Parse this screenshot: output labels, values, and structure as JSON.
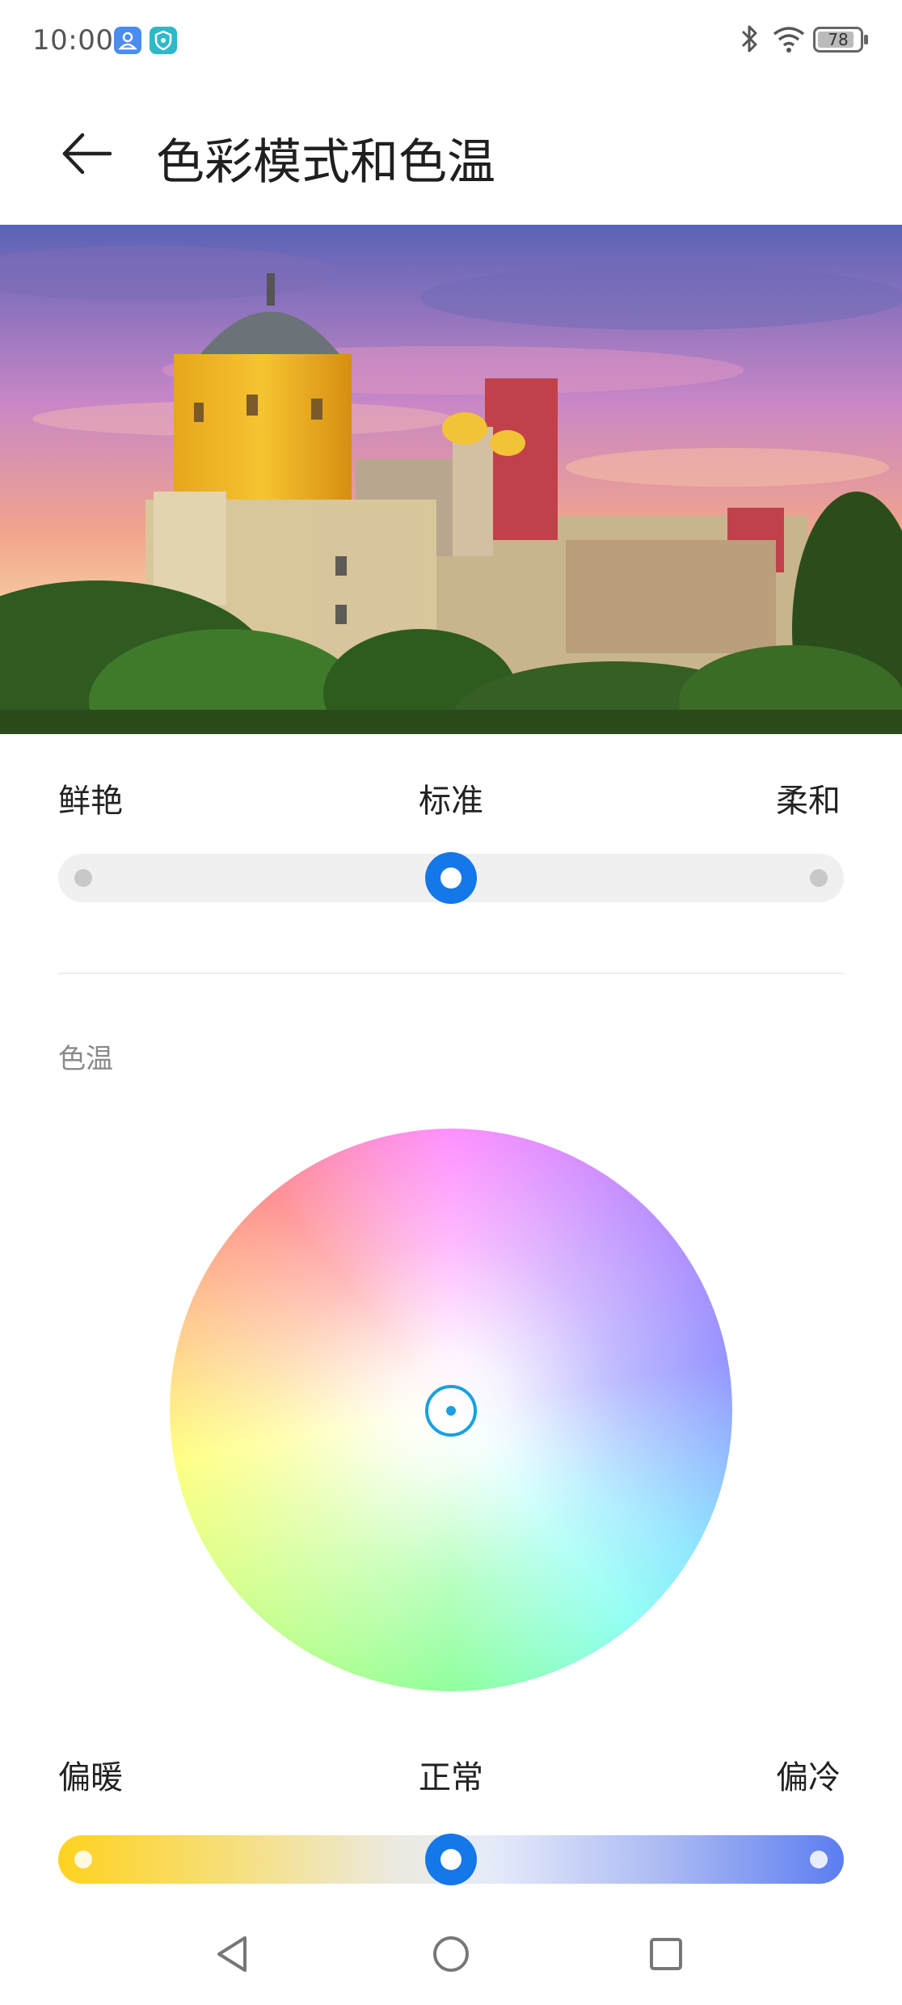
{
  "status_bar": {
    "time": "10:00",
    "battery_level": "78",
    "icons": [
      "user-icon",
      "shield-icon",
      "bluetooth-icon",
      "wifi-icon",
      "battery-icon"
    ]
  },
  "header": {
    "title": "色彩模式和色温",
    "back_icon": "arrow-left-icon"
  },
  "color_mode": {
    "left_label": "鲜艳",
    "center_label": "标准",
    "right_label": "柔和",
    "selected_index": 1,
    "steps": 3
  },
  "color_temperature": {
    "section_title": "色温",
    "left_label": "偏暖",
    "center_label": "正常",
    "right_label": "偏冷",
    "value": 0.5,
    "gradient": [
      "#ffd21f",
      "#ece9dc",
      "#5b7df0"
    ]
  },
  "colors": {
    "accent": "#1478e8",
    "wheel_knob": "#1aa0e0"
  },
  "nav_bar": {
    "icons": [
      "back-triangle-icon",
      "home-circle-icon",
      "recents-square-icon"
    ]
  }
}
